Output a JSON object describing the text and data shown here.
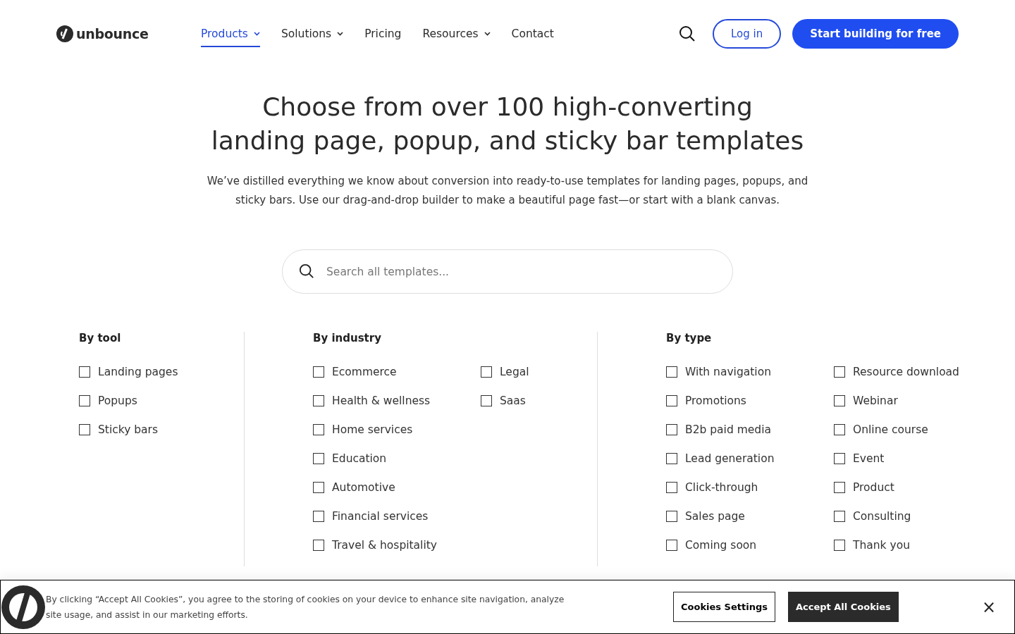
{
  "logo": {
    "text": "unbounce"
  },
  "nav": [
    {
      "label": "Products",
      "has_menu": true,
      "selected": true
    },
    {
      "label": "Solutions",
      "has_menu": true,
      "selected": false
    },
    {
      "label": "Pricing",
      "has_menu": false,
      "selected": false
    },
    {
      "label": "Resources",
      "has_menu": true,
      "selected": false
    },
    {
      "label": "Contact",
      "has_menu": false,
      "selected": false
    }
  ],
  "login": "Log in",
  "cta": "Start building for free",
  "hero": {
    "title_lines": [
      "Choose from over 100 high-converting",
      "landing page, popup, and sticky bar templates"
    ],
    "description": "We’ve distilled everything we know about conversion into ready-to-use templates for landing pages, popups, and sticky bars. Use our drag-and-drop builder to make a beautiful page fast—or start with a blank canvas."
  },
  "search": {
    "placeholder": "Search all templates..."
  },
  "filter_groups": [
    {
      "title": "By tool",
      "columns": [
        [
          {
            "label": "Landing pages",
            "checked": false
          },
          {
            "label": "Popups",
            "checked": false
          },
          {
            "label": "Sticky bars",
            "checked": false
          }
        ]
      ]
    },
    {
      "title": "By industry",
      "columns": [
        [
          {
            "label": "Ecommerce",
            "checked": false
          },
          {
            "label": "Health & wellness",
            "checked": false
          },
          {
            "label": "Home services",
            "checked": false
          },
          {
            "label": "Education",
            "checked": false
          },
          {
            "label": "Automotive",
            "checked": false
          },
          {
            "label": "Financial services",
            "checked": false
          },
          {
            "label": "Travel & hospitality",
            "checked": false
          }
        ],
        [
          {
            "label": "Legal",
            "checked": false
          },
          {
            "label": "Saas",
            "checked": false
          }
        ]
      ]
    },
    {
      "title": "By type",
      "columns": [
        [
          {
            "label": "With navigation",
            "checked": false
          },
          {
            "label": "Promotions",
            "checked": false
          },
          {
            "label": "B2b paid media",
            "checked": false
          },
          {
            "label": "Lead generation",
            "checked": false
          },
          {
            "label": "Click-through",
            "checked": false
          },
          {
            "label": "Sales page",
            "checked": false
          },
          {
            "label": "Coming soon",
            "checked": false
          }
        ],
        [
          {
            "label": "Resource download",
            "checked": false
          },
          {
            "label": "Webinar",
            "checked": false
          },
          {
            "label": "Online course",
            "checked": false
          },
          {
            "label": "Event",
            "checked": false
          },
          {
            "label": "Product",
            "checked": false
          },
          {
            "label": "Consulting",
            "checked": false
          },
          {
            "label": "Thank you",
            "checked": false
          }
        ]
      ]
    }
  ],
  "cookie_banner": {
    "text": "By clicking “Accept All Cookies”, you agree to the storing of cookies on your device to enhance site navigation, analyze site usage, and assist in our marketing efforts.",
    "settings": "Cookies Settings",
    "accept": "Accept All Cookies",
    "close": "×"
  }
}
